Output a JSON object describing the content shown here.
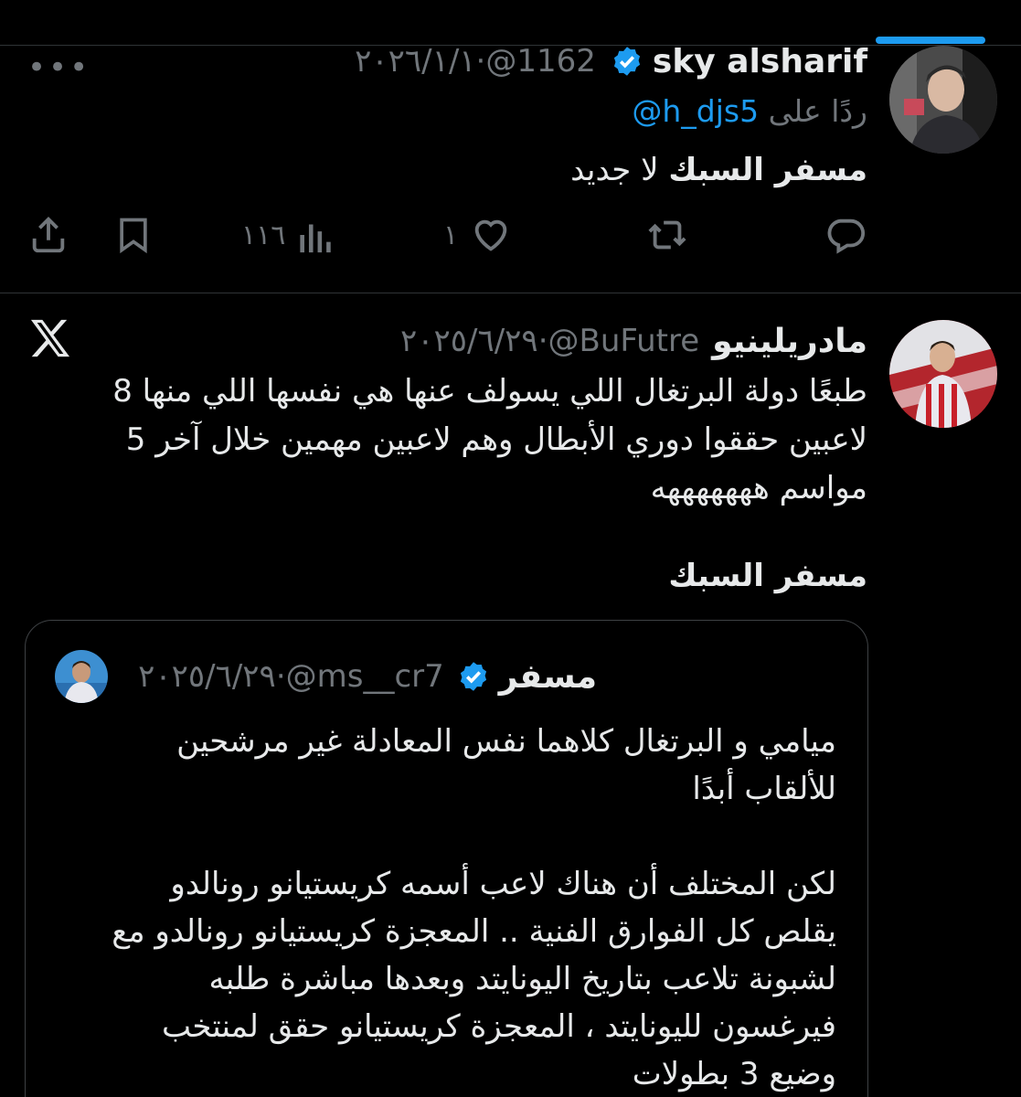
{
  "tabs": {
    "active_indicator_color": "#1d9bf0"
  },
  "tweet1": {
    "author_name": "sky alsharif",
    "verified": true,
    "handle": "@1162",
    "date": "٢٠٢٦/١/١",
    "separator": "·",
    "more_label": "•••",
    "reply_prefix": "ردًا على",
    "reply_handle": "@h_djs5",
    "text_bold": "مسفر السبك",
    "text_rest": " لا جديد",
    "actions": {
      "reply_icon": "reply-icon",
      "retweet_icon": "retweet-icon",
      "like_icon": "heart-icon",
      "like_count": "١",
      "views_icon": "views-icon",
      "views_count": "١١٦",
      "bookmark_icon": "bookmark-icon",
      "share_icon": "share-icon"
    }
  },
  "tweet2": {
    "author_name": "مادريلينيو",
    "handle": "@BuFutre",
    "date": "٢٠٢٥/٦/٢٩",
    "separator": "·",
    "source_icon": "x-logo-icon",
    "lines": [
      "طبعًا دولة البرتغال اللي يسولف عنها هي نفسها اللي منها 8",
      "لاعبين حققوا دوري الأبطال وهم لاعبين مهمين خلال آخر 5",
      "مواسم هههههههه"
    ],
    "mention_bold": "مسفر السبك"
  },
  "quote": {
    "author_name": "مسفر",
    "verified": true,
    "handle": "@ms__cr7",
    "date": "٢٠٢٥/٦/٢٩",
    "separator": "·",
    "para1": [
      "ميامي و البرتغال كلاهما نفس المعادلة غير مرشحين",
      "للألقاب أبدًا"
    ],
    "para2": [
      "لكن المختلف أن هناك لاعب أسمه كريستيانو رونالدو",
      "يقلص كل الفوارق الفنية .. المعجزة كريستيانو رونالدو مع",
      "لشبونة تلاعب بتاريخ اليونايتد وبعدها مباشرة طلبه",
      "فيرغسون لليونايتد ، المعجزة كريستيانو حقق لمنتخب",
      "وضيع 3 بطولات"
    ]
  }
}
